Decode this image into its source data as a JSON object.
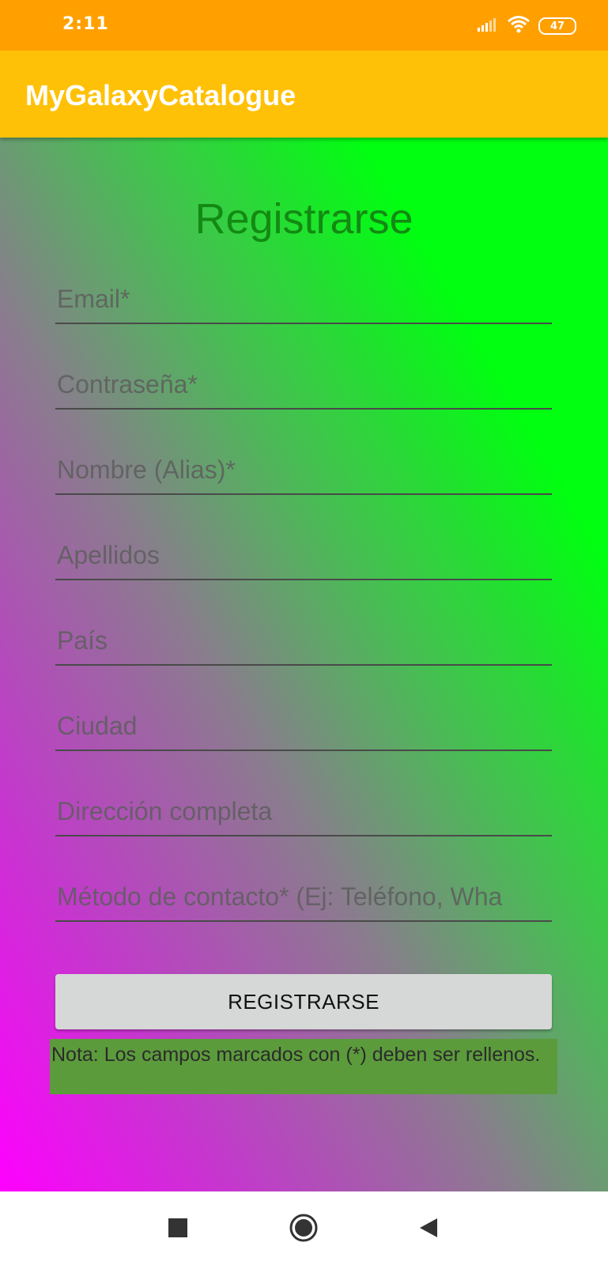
{
  "status": {
    "time": "2:11",
    "battery": "47",
    "icons": [
      "signal-icon",
      "wifi-icon",
      "battery-icon"
    ]
  },
  "app": {
    "title": "MyGalaxyCatalogue"
  },
  "colors": {
    "status_bar": "#FFA000",
    "app_bar": "#FFC107",
    "title_text": "#138A13",
    "gradient_start": "#FF00FF",
    "gradient_end": "#00FF10",
    "note_background": "#5C9B3C",
    "button_background": "#D6D7D7"
  },
  "form": {
    "title": "Registrarse",
    "fields": [
      {
        "name": "email-field",
        "placeholder": "Email*",
        "value": ""
      },
      {
        "name": "password-field",
        "placeholder": "Contraseña*",
        "value": ""
      },
      {
        "name": "name-field",
        "placeholder": "Nombre (Alias)*",
        "value": ""
      },
      {
        "name": "surname-field",
        "placeholder": "Apellidos",
        "value": ""
      },
      {
        "name": "country-field",
        "placeholder": "País",
        "value": ""
      },
      {
        "name": "city-field",
        "placeholder": "Ciudad",
        "value": ""
      },
      {
        "name": "address-field",
        "placeholder": "Dirección completa",
        "value": ""
      },
      {
        "name": "contact-method-field",
        "placeholder": "Método de contacto* (Ej: Teléfono, Wha",
        "value": ""
      }
    ],
    "submit_label": "REGISTRARSE",
    "note": "Nota: Los campos marcados con (*) deben ser rellenos."
  },
  "nav": {
    "buttons": [
      "recents-square-icon",
      "home-circle-icon",
      "back-triangle-icon"
    ]
  }
}
